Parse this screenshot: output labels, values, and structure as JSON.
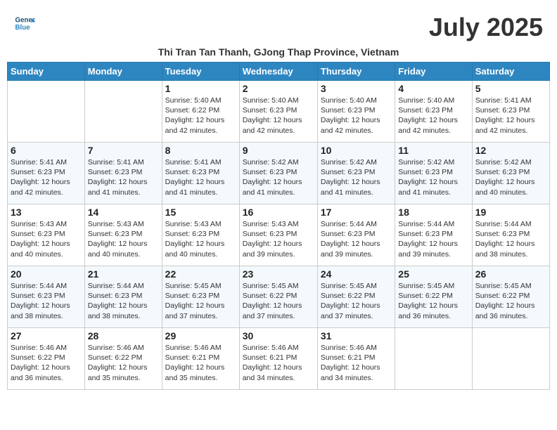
{
  "header": {
    "logo_line1": "General",
    "logo_line2": "Blue",
    "month_title": "July 2025",
    "subtitle": "Thi Tran Tan Thanh, GJong Thap Province, Vietnam"
  },
  "days_of_week": [
    "Sunday",
    "Monday",
    "Tuesday",
    "Wednesday",
    "Thursday",
    "Friday",
    "Saturday"
  ],
  "weeks": [
    [
      {
        "day": "",
        "info": ""
      },
      {
        "day": "",
        "info": ""
      },
      {
        "day": "1",
        "info": "Sunrise: 5:40 AM\nSunset: 6:22 PM\nDaylight: 12 hours and 42 minutes."
      },
      {
        "day": "2",
        "info": "Sunrise: 5:40 AM\nSunset: 6:23 PM\nDaylight: 12 hours and 42 minutes."
      },
      {
        "day": "3",
        "info": "Sunrise: 5:40 AM\nSunset: 6:23 PM\nDaylight: 12 hours and 42 minutes."
      },
      {
        "day": "4",
        "info": "Sunrise: 5:40 AM\nSunset: 6:23 PM\nDaylight: 12 hours and 42 minutes."
      },
      {
        "day": "5",
        "info": "Sunrise: 5:41 AM\nSunset: 6:23 PM\nDaylight: 12 hours and 42 minutes."
      }
    ],
    [
      {
        "day": "6",
        "info": "Sunrise: 5:41 AM\nSunset: 6:23 PM\nDaylight: 12 hours and 42 minutes."
      },
      {
        "day": "7",
        "info": "Sunrise: 5:41 AM\nSunset: 6:23 PM\nDaylight: 12 hours and 41 minutes."
      },
      {
        "day": "8",
        "info": "Sunrise: 5:41 AM\nSunset: 6:23 PM\nDaylight: 12 hours and 41 minutes."
      },
      {
        "day": "9",
        "info": "Sunrise: 5:42 AM\nSunset: 6:23 PM\nDaylight: 12 hours and 41 minutes."
      },
      {
        "day": "10",
        "info": "Sunrise: 5:42 AM\nSunset: 6:23 PM\nDaylight: 12 hours and 41 minutes."
      },
      {
        "day": "11",
        "info": "Sunrise: 5:42 AM\nSunset: 6:23 PM\nDaylight: 12 hours and 41 minutes."
      },
      {
        "day": "12",
        "info": "Sunrise: 5:42 AM\nSunset: 6:23 PM\nDaylight: 12 hours and 40 minutes."
      }
    ],
    [
      {
        "day": "13",
        "info": "Sunrise: 5:43 AM\nSunset: 6:23 PM\nDaylight: 12 hours and 40 minutes."
      },
      {
        "day": "14",
        "info": "Sunrise: 5:43 AM\nSunset: 6:23 PM\nDaylight: 12 hours and 40 minutes."
      },
      {
        "day": "15",
        "info": "Sunrise: 5:43 AM\nSunset: 6:23 PM\nDaylight: 12 hours and 40 minutes."
      },
      {
        "day": "16",
        "info": "Sunrise: 5:43 AM\nSunset: 6:23 PM\nDaylight: 12 hours and 39 minutes."
      },
      {
        "day": "17",
        "info": "Sunrise: 5:44 AM\nSunset: 6:23 PM\nDaylight: 12 hours and 39 minutes."
      },
      {
        "day": "18",
        "info": "Sunrise: 5:44 AM\nSunset: 6:23 PM\nDaylight: 12 hours and 39 minutes."
      },
      {
        "day": "19",
        "info": "Sunrise: 5:44 AM\nSunset: 6:23 PM\nDaylight: 12 hours and 38 minutes."
      }
    ],
    [
      {
        "day": "20",
        "info": "Sunrise: 5:44 AM\nSunset: 6:23 PM\nDaylight: 12 hours and 38 minutes."
      },
      {
        "day": "21",
        "info": "Sunrise: 5:44 AM\nSunset: 6:23 PM\nDaylight: 12 hours and 38 minutes."
      },
      {
        "day": "22",
        "info": "Sunrise: 5:45 AM\nSunset: 6:23 PM\nDaylight: 12 hours and 37 minutes."
      },
      {
        "day": "23",
        "info": "Sunrise: 5:45 AM\nSunset: 6:22 PM\nDaylight: 12 hours and 37 minutes."
      },
      {
        "day": "24",
        "info": "Sunrise: 5:45 AM\nSunset: 6:22 PM\nDaylight: 12 hours and 37 minutes."
      },
      {
        "day": "25",
        "info": "Sunrise: 5:45 AM\nSunset: 6:22 PM\nDaylight: 12 hours and 36 minutes."
      },
      {
        "day": "26",
        "info": "Sunrise: 5:45 AM\nSunset: 6:22 PM\nDaylight: 12 hours and 36 minutes."
      }
    ],
    [
      {
        "day": "27",
        "info": "Sunrise: 5:46 AM\nSunset: 6:22 PM\nDaylight: 12 hours and 36 minutes."
      },
      {
        "day": "28",
        "info": "Sunrise: 5:46 AM\nSunset: 6:22 PM\nDaylight: 12 hours and 35 minutes."
      },
      {
        "day": "29",
        "info": "Sunrise: 5:46 AM\nSunset: 6:21 PM\nDaylight: 12 hours and 35 minutes."
      },
      {
        "day": "30",
        "info": "Sunrise: 5:46 AM\nSunset: 6:21 PM\nDaylight: 12 hours and 34 minutes."
      },
      {
        "day": "31",
        "info": "Sunrise: 5:46 AM\nSunset: 6:21 PM\nDaylight: 12 hours and 34 minutes."
      },
      {
        "day": "",
        "info": ""
      },
      {
        "day": "",
        "info": ""
      }
    ]
  ]
}
